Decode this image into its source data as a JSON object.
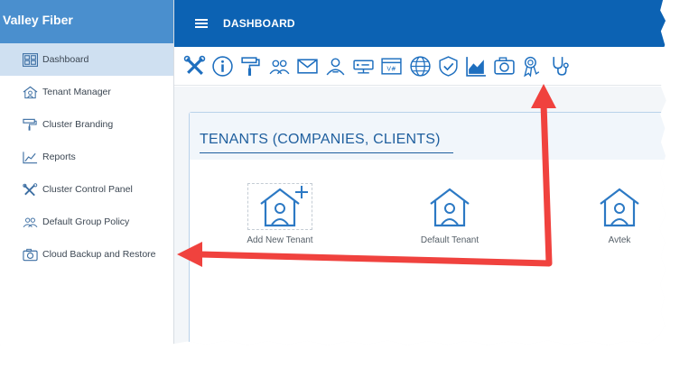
{
  "sidebar": {
    "brand": "Valley Fiber",
    "items": [
      {
        "label": "Dashboard",
        "icon": "dashboard-grid-icon",
        "active": true
      },
      {
        "label": "Tenant Manager",
        "icon": "house-users-icon",
        "active": false
      },
      {
        "label": "Cluster Branding",
        "icon": "paint-roller-icon",
        "active": false
      },
      {
        "label": "Reports",
        "icon": "line-chart-icon",
        "active": false
      },
      {
        "label": "Cluster Control Panel",
        "icon": "tools-icon",
        "active": false
      },
      {
        "label": "Default Group Policy",
        "icon": "user-group-icon",
        "active": false
      },
      {
        "label": "Cloud Backup and Restore",
        "icon": "camera-icon",
        "active": false
      }
    ]
  },
  "topbar": {
    "title": "DASHBOARD",
    "menu_icon": "hamburger-menu-icon"
  },
  "toolbar": {
    "tools": [
      "tools-icon",
      "info-icon",
      "paint-roller-icon",
      "user-group-icon",
      "mail-icon",
      "user-settings-icon",
      "server-icon",
      "browser-code-icon",
      "globe-icon",
      "shield-check-icon",
      "area-chart-icon",
      "camera-icon",
      "award-ribbon-icon",
      "stethoscope-icon"
    ]
  },
  "main": {
    "panel_title": "TENANTS (COMPANIES, CLIENTS)",
    "tenants": [
      {
        "label": "Add New Tenant",
        "icon": "house-user-add-icon"
      },
      {
        "label": "Default Tenant",
        "icon": "house-user-icon"
      },
      {
        "label": "Avtek",
        "icon": "house-user-icon"
      }
    ]
  },
  "colors": {
    "brand_bg": "#4a8fce",
    "topbar_bg": "#0c62b3",
    "active_item_bg": "#cfe0f1",
    "icon_blue": "#1e6fbf",
    "arrow_red": "#f0423e"
  }
}
